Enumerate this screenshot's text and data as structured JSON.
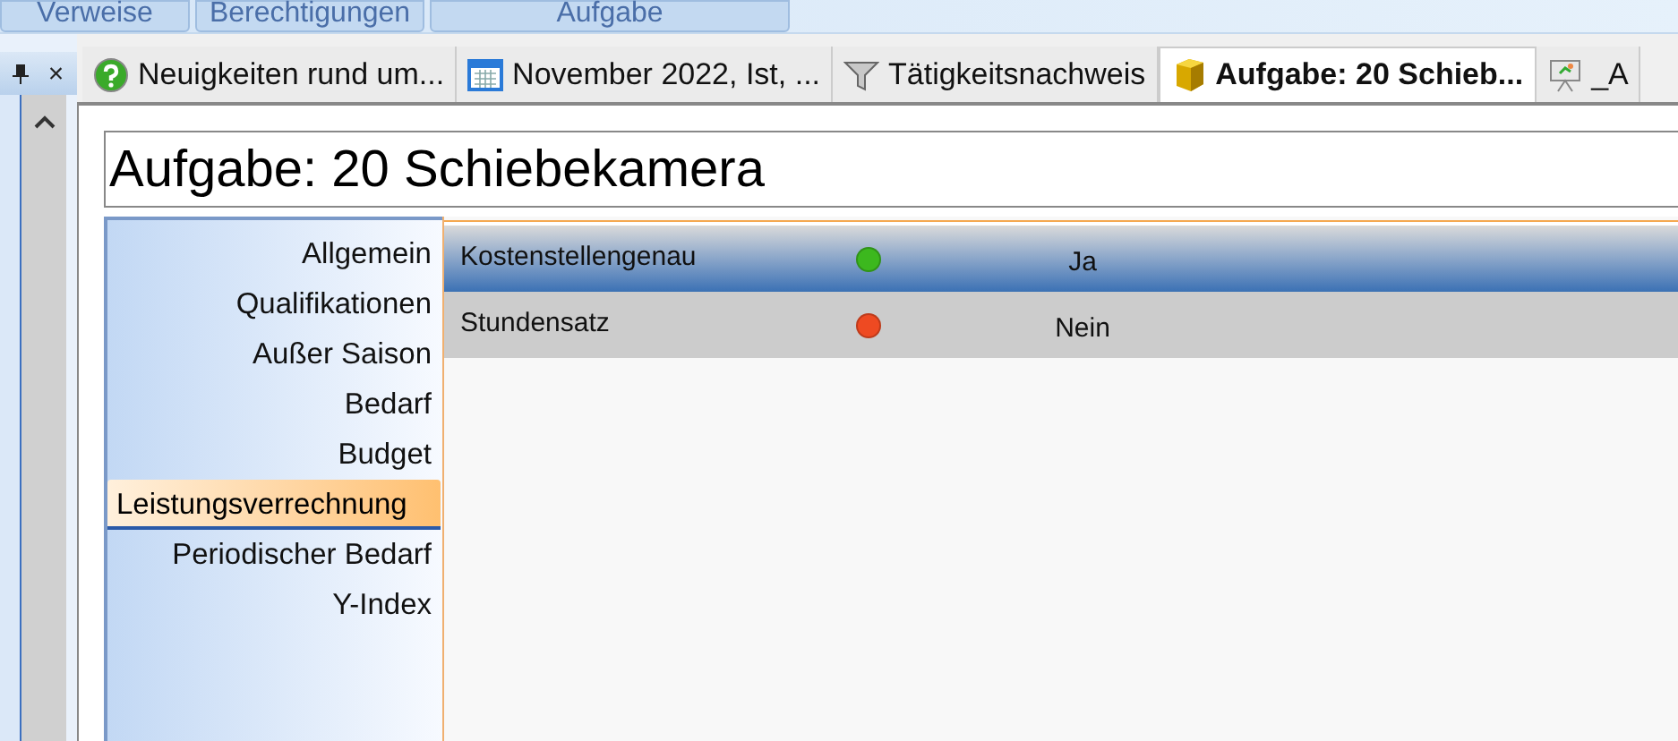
{
  "ribbon_tabs": [
    {
      "label": "Verweise"
    },
    {
      "label": "Berechtigungen"
    },
    {
      "label": "Aufgabe"
    }
  ],
  "side_panel": {
    "close": "×"
  },
  "document_tabs": [
    {
      "label": "Neuigkeiten rund um...",
      "kind": "help",
      "selected": false
    },
    {
      "label": "November 2022, Ist, ...",
      "kind": "calendar",
      "selected": false
    },
    {
      "label": "Tätigkeitsnachweis",
      "kind": "funnel",
      "selected": false
    },
    {
      "label": "Aufgabe: 20 Schieb...",
      "kind": "cube",
      "selected": true
    },
    {
      "label": "_A",
      "kind": "easel",
      "selected": false
    }
  ],
  "title": "Aufgabe: 20 Schiebekamera",
  "nav_items": [
    {
      "label": "Allgemein",
      "selected": false
    },
    {
      "label": "Qualifikationen",
      "selected": false
    },
    {
      "label": "Außer Saison",
      "selected": false
    },
    {
      "label": "Bedarf",
      "selected": false
    },
    {
      "label": "Budget",
      "selected": false
    },
    {
      "label": "Leistungsverrechnung",
      "selected": true
    },
    {
      "label": "Periodischer Bedarf",
      "selected": false
    },
    {
      "label": "Y-Index",
      "selected": false
    }
  ],
  "rows": [
    {
      "name": "Kostenstellengenau",
      "color": "#3cb81e",
      "value": "Ja",
      "selected": true
    },
    {
      "name": "Stundensatz",
      "color": "#ee4a22",
      "value": "Nein",
      "selected": false
    }
  ]
}
